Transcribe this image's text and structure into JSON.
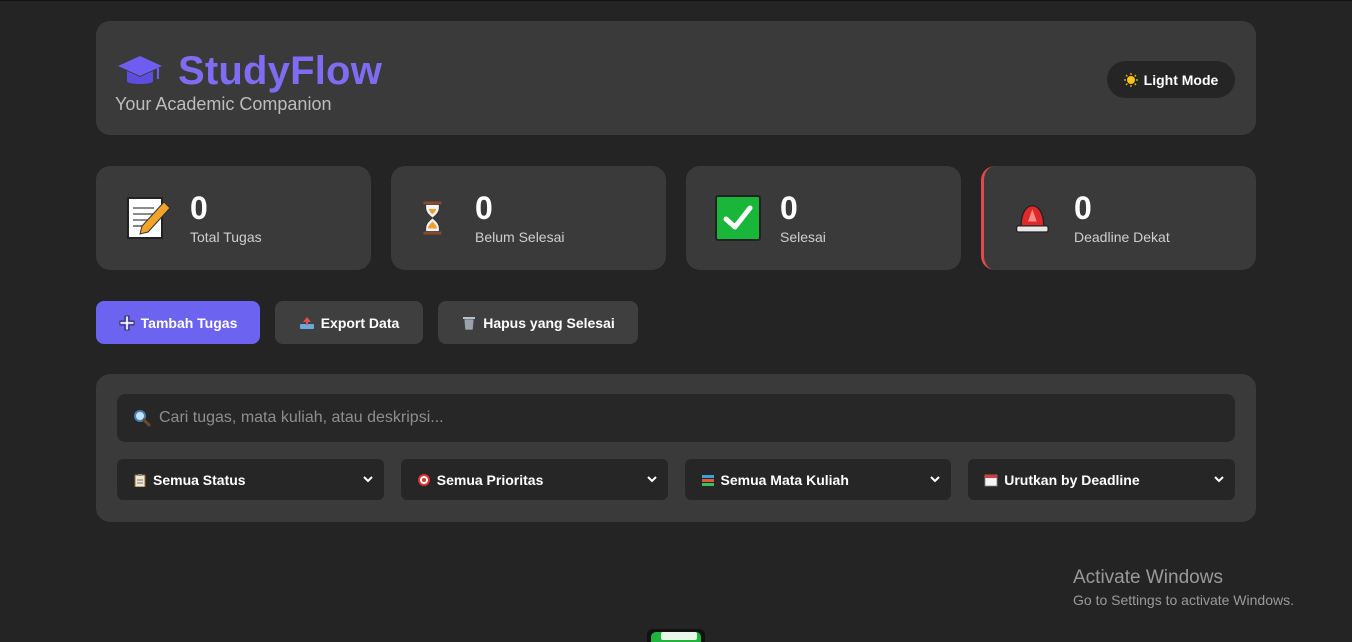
{
  "header": {
    "brand_title": "StudyFlow",
    "tagline": "Your Academic Companion",
    "brand_icon": "graduation-cap-icon",
    "theme_toggle_label": "Light Mode",
    "theme_toggle_icon": "sun-icon"
  },
  "stats": [
    {
      "value": "0",
      "label": "Total Tugas",
      "icon": "memo-icon"
    },
    {
      "value": "0",
      "label": "Belum Selesai",
      "icon": "hourglass-icon"
    },
    {
      "value": "0",
      "label": "Selesai",
      "icon": "check-mark-icon"
    },
    {
      "value": "0",
      "label": "Deadline Dekat",
      "icon": "siren-icon"
    }
  ],
  "actions": {
    "add_label": "Tambah Tugas",
    "export_label": "Export Data",
    "clear_label": "Hapus yang Selesai"
  },
  "filters": {
    "search_placeholder": "Cari tugas, mata kuliah, atau deskripsi...",
    "status": "Semua Status",
    "priority": "Semua Prioritas",
    "course": "Semua Mata Kuliah",
    "sort": "Urutkan by Deadline"
  },
  "os_overlay": {
    "title": "Activate Windows",
    "subtitle": "Go to Settings to activate Windows."
  },
  "colors": {
    "accent": "#7f6cf2",
    "primary_button": "#6c63f0",
    "alert_border": "#e04a4a",
    "card_bg": "#3a3a3a",
    "page_bg": "#242424"
  }
}
